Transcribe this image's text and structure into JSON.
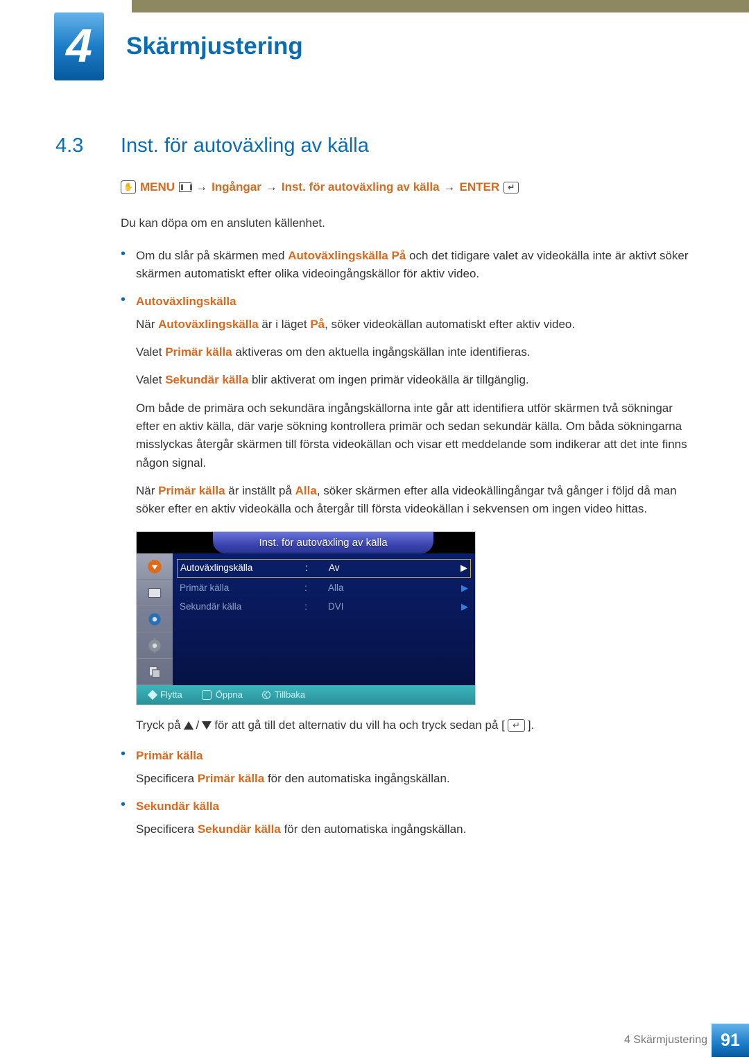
{
  "chapter": {
    "number": "4",
    "title": "Skärmjustering"
  },
  "section": {
    "number": "4.3",
    "title": "Inst. för autoväxling av källa"
  },
  "nav_path": {
    "menu": "MENU",
    "p1": "Ingångar",
    "p2": "Inst. för autoväxling av källa",
    "enter": "ENTER"
  },
  "intro": "Du kan döpa om en ansluten källenhet.",
  "note_bullet": {
    "pre": "Om du slår på skärmen med ",
    "hl": "Autoväxlingskälla På",
    "post": " och det tidigare valet av videokälla inte är aktivt söker skärmen automatiskt efter olika videoingångskällor för aktiv video."
  },
  "b_auto": {
    "title": "Autoväxlingskälla",
    "p1a": "När ",
    "p1b": "Autoväxlingskälla",
    "p1c": " är i läget ",
    "p1d": "På",
    "p1e": ", söker videokällan automatiskt efter aktiv video.",
    "p2a": "Valet ",
    "p2b": "Primär källa",
    "p2c": " aktiveras om den aktuella ingångskällan inte identifieras.",
    "p3a": "Valet ",
    "p3b": "Sekundär källa",
    "p3c": " blir aktiverat om ingen primär videokälla är tillgänglig.",
    "p4": "Om både de primära och sekundära ingångskällorna inte går att identifiera utför skärmen två sökningar efter en aktiv källa, där varje sökning kontrollera primär och sedan sekundär källa. Om båda sökningarna misslyckas återgår skärmen till första videokällan och visar ett meddelande som indikerar att det inte finns någon signal.",
    "p5a": "När ",
    "p5b": "Primär källa",
    "p5c": " är inställt på ",
    "p5d": "Alla",
    "p5e": ", söker skärmen efter alla videokällingångar två gånger i följd då man söker efter en aktiv videokälla och återgår till första videokällan i sekvensen om ingen video hittas."
  },
  "osd": {
    "title": "Inst. för autoväxling av källa",
    "rows": [
      {
        "label": "Autoväxlingskälla",
        "sep": ":",
        "value": "Av",
        "arrow": "▶"
      },
      {
        "label": "Primär källa",
        "sep": ":",
        "value": "Alla",
        "arrow": "▶"
      },
      {
        "label": "Sekundär källa",
        "sep": ":",
        "value": "DVI",
        "arrow": "▶"
      }
    ],
    "footer": {
      "move": "Flytta",
      "open": "Öppna",
      "back": "Tillbaka"
    }
  },
  "press": {
    "pre": "Tryck på ",
    "mid": " för att gå till det alternativ du vill ha och tryck sedan på [",
    "post": "]."
  },
  "b_prim": {
    "title": "Primär källa",
    "t1": "Specificera ",
    "t2": "Primär källa",
    "t3": " för den automatiska ingångskällan."
  },
  "b_sek": {
    "title": "Sekundär källa",
    "t1": "Specificera ",
    "t2": "Sekundär källa",
    "t3": " för den automatiska ingångskällan."
  },
  "footer": {
    "label": "4 Skärmjustering",
    "page": "91"
  }
}
